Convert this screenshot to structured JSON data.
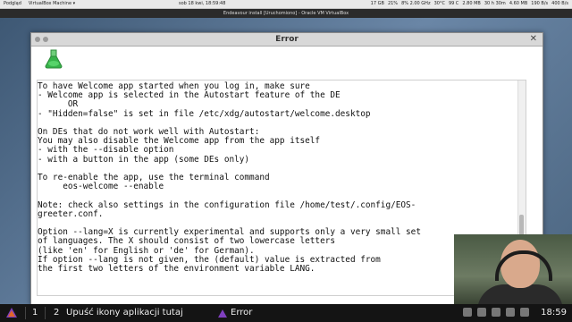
{
  "host_topbar": {
    "left_items": [
      "Podgląd",
      "VirtualBox Machine ▾"
    ],
    "center_items": [
      "sob 18 kwi, 18:59:48"
    ],
    "right_items": [
      "17 GB",
      "21%",
      "8% 2.00 GHz",
      "30°C",
      "99 C",
      "2.80 MB",
      "30 h 30m",
      "4.60 MB",
      "190 B/s",
      "400 B/s"
    ]
  },
  "vm_window": {
    "title": "Endeavour install [Uruchomiono] - Oracle VM VirtualBox"
  },
  "error_dialog": {
    "title": "Error",
    "close_label": "✕",
    "message_lines": [
      "To have Welcome app started when you log in, make sure",
      "- Welcome app is selected in the Autostart feature of the DE",
      "      OR",
      "- \"Hidden=false\" is set in file /etc/xdg/autostart/welcome.desktop",
      "",
      "On DEs that do not work well with Autostart:",
      "You may also disable the Welcome app from the app itself",
      "- with the --disable option",
      "- with a button in the app (some DEs only)",
      "",
      "To re-enable the app, use the terminal command",
      "     eos-welcome --enable",
      "",
      "Note: check also settings in the configuration file /home/test/.config/EOS-",
      "greeter.conf.",
      "",
      "Option --lang=X is currently experimental and supports only a very small set",
      "of languages. The X should consist of two lowercase letters",
      "(like 'en' for English or 'de' for German).",
      "If option --lang is not given, the (default) value is extracted from",
      "the first two letters of the environment variable LANG."
    ]
  },
  "taskbar": {
    "workspace_1": "1",
    "workspace_2": "2",
    "task_1": "Upuść ikony aplikacji tutaj",
    "task_2": "Error",
    "clock": "18:59"
  },
  "colors": {
    "flask_green": "#37b24a",
    "taskbar_bg": "#141414",
    "endeavour_purple": "#7f3fbf"
  }
}
